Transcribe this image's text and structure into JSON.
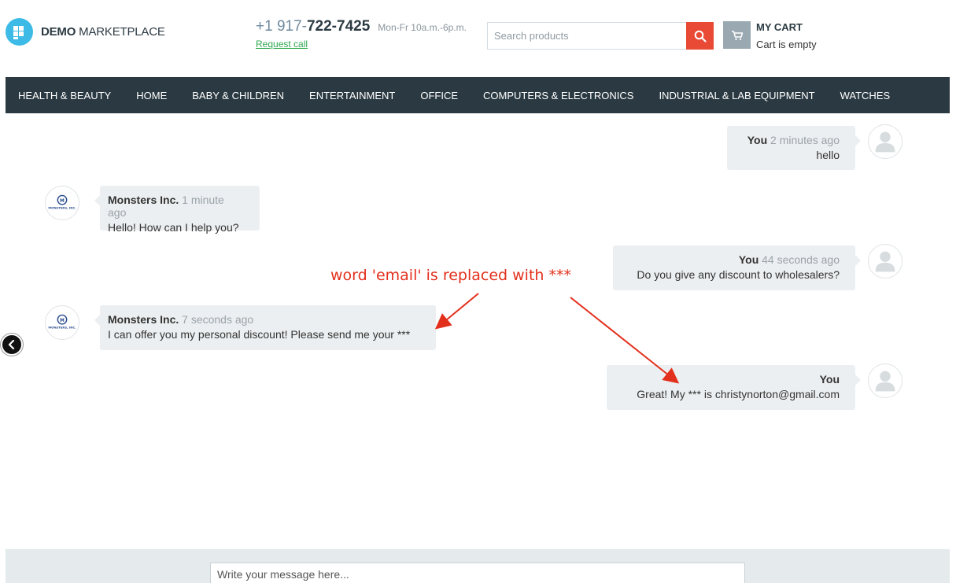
{
  "header": {
    "logo_bold": "DEMO",
    "logo_light": "MARKETPLACE",
    "phone_prefix": "+1 917-",
    "phone_main": "722-7425",
    "hours": "Mon-Fr 10a.m.-6p.m.",
    "request_call": "Request call",
    "search_placeholder": "Search products",
    "cart_title": "MY CART",
    "cart_status": "Cart is empty"
  },
  "nav": {
    "items": [
      "HEALTH & BEAUTY",
      "HOME",
      "BABY & CHILDREN",
      "ENTERTAINMENT",
      "OFFICE",
      "COMPUTERS & ELECTRONICS",
      "INDUSTRIAL & LAB EQUIPMENT",
      "WATCHES"
    ]
  },
  "chat": {
    "messages": [
      {
        "side": "right",
        "author": "You",
        "time": "2 minutes ago",
        "text": "hello"
      },
      {
        "side": "left",
        "author": "Monsters Inc.",
        "time": "1 minute ago",
        "text": "Hello! How can I help you?"
      },
      {
        "side": "right",
        "author": "You",
        "time": "44 seconds ago",
        "text": "Do you give any discount to wholesalers?"
      },
      {
        "side": "left",
        "author": "Monsters Inc.",
        "time": "7 seconds ago",
        "text": "I can offer you my personal discount! Please send me your ***"
      },
      {
        "side": "right",
        "author": "You",
        "time": "",
        "text": "Great! My *** is christynorton@gmail.com"
      }
    ],
    "vendor_logo_text": "MONSTERS, INC."
  },
  "annotation": "word 'email' is replaced with ***",
  "composer": {
    "placeholder": "Write your message here..."
  },
  "colors": {
    "nav_bg": "#2b3a42",
    "search_button": "#e84a36",
    "logo": "#3dbbe6",
    "annotation": "#e3301d",
    "request_call": "#2fa84f"
  }
}
